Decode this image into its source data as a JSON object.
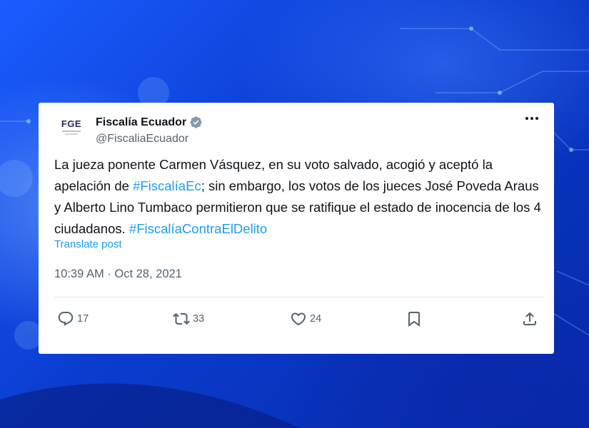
{
  "tweet": {
    "avatar_text": "FGE",
    "display_name": "Fiscalía Ecuador",
    "handle": "@FiscaliaEcuador",
    "body": {
      "segment_1": "La jueza ponente Carmen Vásquez, en su voto salvado, acogió y aceptó la apelación de ",
      "hashtag_1": "#FiscalíaEc",
      "segment_2": "; sin embargo, los votos de los jueces José Poveda Araus y Alberto Lino Tumbaco permitieron que se ratifique el estado de inocencia de los 4 ciudadanos. ",
      "hashtag_2": "#FiscalíaContraElDelito"
    },
    "translate_label": "Translate post",
    "timestamp": "10:39 AM · Oct 28, 2021",
    "stats": {
      "replies": "17",
      "reposts": "33",
      "likes": "24"
    }
  },
  "colors": {
    "link": "#1d9bf0",
    "secondary_text": "#536471",
    "verified_badge": "#829aab",
    "background": "#0a3fd6"
  },
  "icons": {
    "verified": "verified-badge-icon",
    "more": "more-options-icon",
    "reply": "reply-icon",
    "repost": "repost-icon",
    "like": "like-icon",
    "bookmark": "bookmark-icon",
    "share": "share-icon"
  }
}
